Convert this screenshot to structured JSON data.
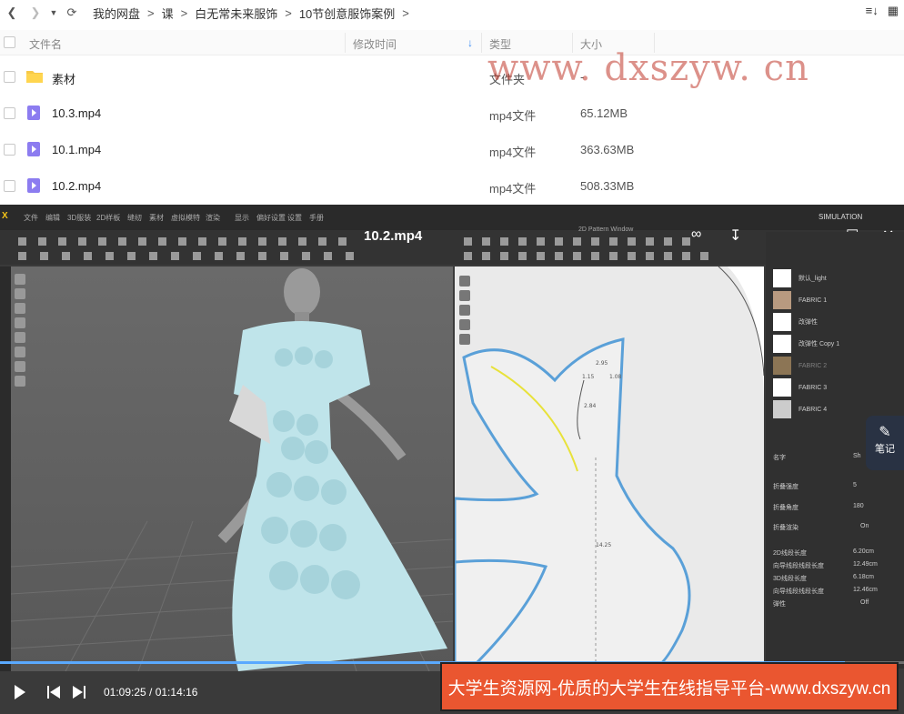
{
  "nav": {
    "breadcrumbs": [
      "我的网盘",
      "课",
      "白无常未来服饰",
      "10节创意服饰案例"
    ]
  },
  "table": {
    "headers": {
      "name": "文件名",
      "modified": "修改时间",
      "type": "类型",
      "size": "大小"
    },
    "rows": [
      {
        "name": "素材",
        "type": "文件夹",
        "size": "-",
        "icon": "folder-icon"
      },
      {
        "name": "10.3.mp4",
        "type": "mp4文件",
        "size": "65.12MB",
        "icon": "video-file-icon"
      },
      {
        "name": "10.1.mp4",
        "type": "mp4文件",
        "size": "363.63MB",
        "icon": "video-file-icon"
      },
      {
        "name": "10.2.mp4",
        "type": "mp4文件",
        "size": "508.33MB",
        "icon": "video-file-icon"
      }
    ]
  },
  "watermark": "www. dxszyw. cn",
  "player": {
    "title": "10.2.mp4",
    "time": "01:09:25 / 01:14:16",
    "progress": 0.935,
    "note_label": "笔记",
    "banner": "大学生资源网-优质的大学生在线指导平台-www.dxszyw.cn",
    "app": {
      "menu": [
        "文件",
        "编辑",
        "3D服装",
        "2D样板",
        "缝纫",
        "素材",
        "虚拟模特",
        "渲染",
        "显示",
        "偏好设置",
        "设置",
        "手册"
      ],
      "pattern_window": "2D Pattern Window",
      "simulation": "SIMULATION",
      "fabrics": [
        "默认_light",
        "FABRIC 1",
        "改弹性",
        "改弹性 Copy 1",
        "FABRIC 2",
        "FABRIC 3",
        "FABRIC 4"
      ],
      "props": [
        {
          "k": "名字",
          "v": "Sh"
        },
        {
          "k": "折叠强度",
          "v": "5"
        },
        {
          "k": "折叠角度",
          "v": "180"
        },
        {
          "k": "折叠渲染",
          "v": "On"
        },
        {
          "k": "2D线段长度",
          "v": "6.20cm"
        },
        {
          "k": "向导线段线段长度",
          "v": "12.49cm"
        },
        {
          "k": "3D线段长度",
          "v": "6.18cm"
        },
        {
          "k": "向导线段线段长度",
          "v": "12.46cm"
        },
        {
          "k": "弹性",
          "v": "Off"
        }
      ],
      "measures": [
        "2.95",
        "1.15",
        "1.08",
        "2.84",
        "14.25"
      ]
    }
  }
}
